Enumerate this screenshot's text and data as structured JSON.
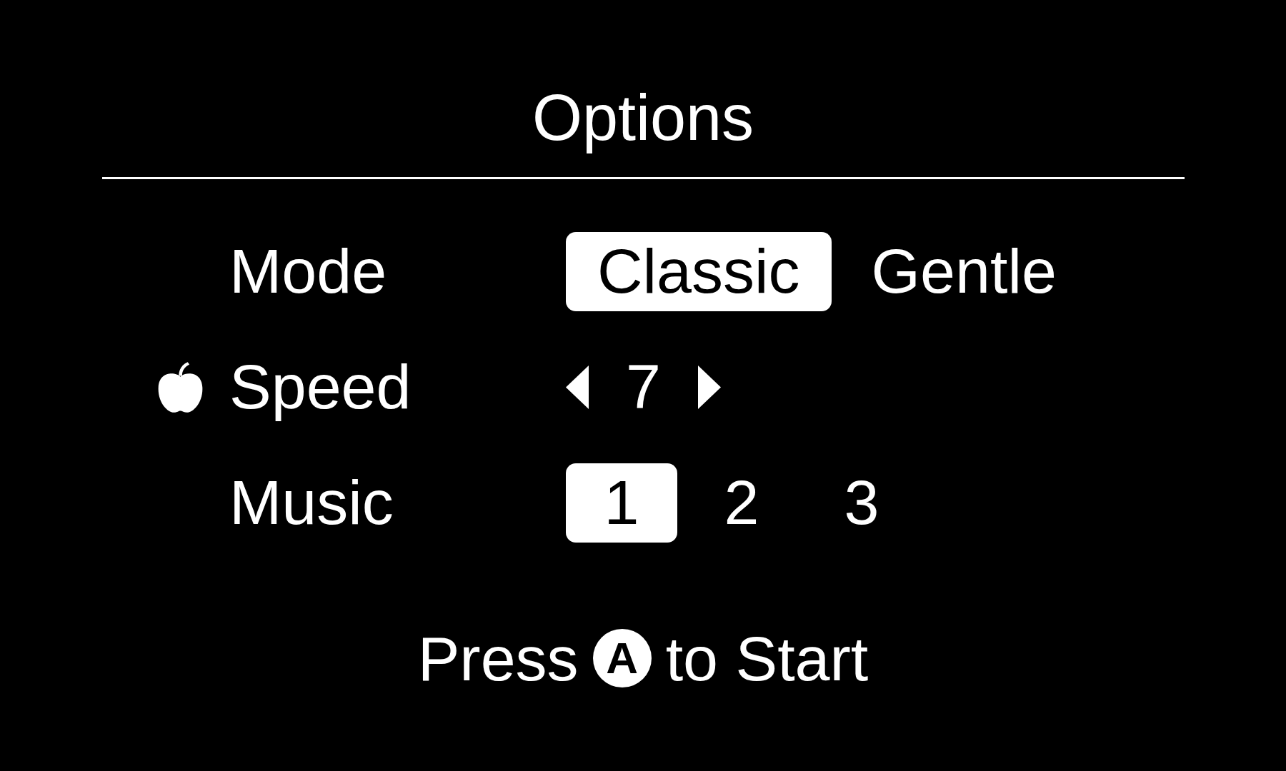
{
  "title": "Options",
  "rows": [
    {
      "label": "Mode",
      "kind": "choice",
      "cursor": false,
      "options": [
        {
          "label": "Classic",
          "selected": true
        },
        {
          "label": "Gentle",
          "selected": false
        }
      ]
    },
    {
      "label": "Speed",
      "kind": "stepper",
      "cursor": true,
      "value": "7"
    },
    {
      "label": "Music",
      "kind": "choice",
      "cursor": false,
      "options": [
        {
          "label": "1",
          "selected": true
        },
        {
          "label": "2",
          "selected": false
        },
        {
          "label": "3",
          "selected": false
        }
      ]
    }
  ],
  "prompt": {
    "before": "Press",
    "key": "A",
    "after": "to Start"
  }
}
